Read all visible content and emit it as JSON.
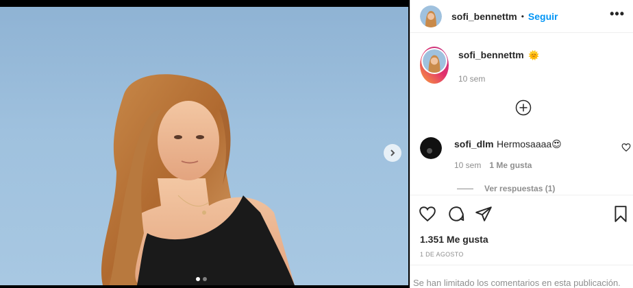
{
  "post": {
    "username": "sofi_bennettm",
    "follow_label": "Seguir",
    "separator": "•",
    "more_label": "•••",
    "caption_emoji": "🌞",
    "caption_time": "10 sem",
    "carousel": {
      "count": 2,
      "active": 0
    }
  },
  "comment": {
    "username": "sofi_dlm",
    "text": "Hermosaaaa😍",
    "time": "10 sem",
    "likes": "1 Me gusta",
    "replies": "Ver respuestas (1)"
  },
  "footer": {
    "likes": "1.351 Me gusta",
    "date": "1 de agosto",
    "limited": "Se han limitado los comentarios en esta publicación."
  },
  "icons": [
    "chevron-right-icon",
    "plus-circle-icon",
    "heart-icon",
    "comment-icon",
    "share-icon",
    "bookmark-icon"
  ],
  "colors": {
    "link": "#0095f6",
    "text": "#262626",
    "muted": "#8e8e8e"
  }
}
